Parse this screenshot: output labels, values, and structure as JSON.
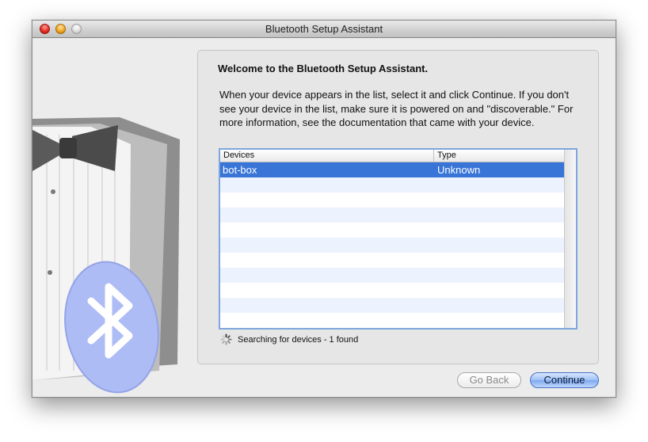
{
  "window": {
    "title": "Bluetooth Setup Assistant"
  },
  "content": {
    "heading": "Welcome to the Bluetooth Setup Assistant.",
    "description": "When your device appears in the list, select it and click Continue. If you don't see your device in the list, make sure it is powered on and \"discoverable.\" For more information, see the documentation that came with your device."
  },
  "table": {
    "columns": [
      "Devices",
      "Type"
    ],
    "rows": [
      {
        "device": "bot-box",
        "type": "Unknown",
        "selected": true
      }
    ]
  },
  "status": {
    "text": "Searching for devices - 1 found",
    "icon": "spinner-icon"
  },
  "buttons": {
    "back": "Go Back",
    "continue": "Continue",
    "back_enabled": false
  },
  "colors": {
    "selection": "#3875d7",
    "focus_ring": "#7fa6dc",
    "default_button": "#7ea8ef",
    "bluetooth_badge": "#aebcf5"
  }
}
